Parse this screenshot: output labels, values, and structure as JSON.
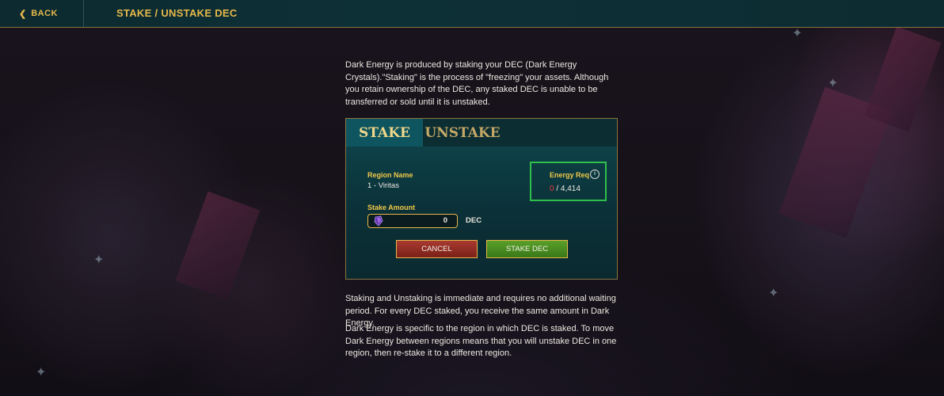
{
  "header": {
    "back_label": "BACK",
    "title": "STAKE / UNSTAKE DEC"
  },
  "intro_text": "Dark Energy is produced by staking your DEC (Dark Energy Crystals).\"Staking\" is the process of \"freezing\" your assets. Although you retain ownership of the DEC, any staked DEC is unable to be transferred or sold until it is unstaked.",
  "tabs": [
    {
      "label": "STAKE",
      "active": true
    },
    {
      "label": "UNSTAKE",
      "active": false
    }
  ],
  "form": {
    "region_label": "Region Name",
    "region_value": "1 - Viritas",
    "stake_amount_label": "Stake Amount",
    "stake_amount_value": "0",
    "unit": "DEC",
    "energy_label": "Energy Req",
    "energy_current": "0",
    "energy_required": "/ 4,414",
    "cancel_label": "CANCEL",
    "stake_label": "STAKE DEC"
  },
  "info_paragraphs": [
    "Staking and Unstaking is immediate and requires no additional waiting period. For every DEC staked, you receive the same amount in Dark Energy.",
    "Dark Energy is specific to the region in which DEC is staked. To move Dark Energy between regions means that you will unstake DEC in one region, then re-stake it to a different region."
  ],
  "icons": {
    "back": "chevron-left-icon",
    "info": "info-icon",
    "currency": "dec-crystal-icon"
  },
  "colors": {
    "accent_gold": "#e6b84a",
    "highlight_green": "#2ec04a",
    "energy_current_red": "#e83a3a"
  }
}
